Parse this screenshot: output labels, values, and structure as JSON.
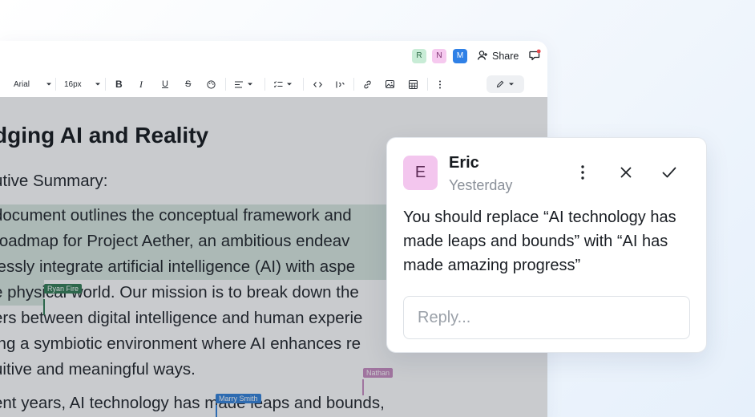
{
  "topbar": {
    "collaborators": [
      {
        "initial": "R",
        "bg": "#c8ecd6",
        "fg": "#2e6b47"
      },
      {
        "initial": "N",
        "bg": "#f6c9ef",
        "fg": "#7a2f6e"
      },
      {
        "initial": "M",
        "bg": "#2f80e6",
        "fg": "#ffffff"
      }
    ],
    "share_label": "Share",
    "notification_color": "#e5484d"
  },
  "toolbar": {
    "font_family": "Arial",
    "font_size": "16px"
  },
  "document": {
    "title": "dging AI and Reality",
    "section": "utive Summary:",
    "lines": [
      "document outlines the conceptual framework and",
      " roadmap for Project Aether, an ambitious endeav",
      "lessly integrate artificial intelligence (AI) with aspe",
      "e physical world. Our mission is to break down the",
      "ers between digital intelligence and human experie",
      "ing a symbiotic environment where AI enhances re",
      "uitive and meaningful ways."
    ],
    "next_paragraph": "ent years, AI technology has made leaps and bounds,",
    "cursors": [
      {
        "name": "Ryan Fire",
        "color": "#2f7a52"
      },
      {
        "name": "Nathan",
        "color": "#c98bc0"
      },
      {
        "name": "Marry Smith",
        "color": "#2f7fd8"
      }
    ]
  },
  "comment": {
    "author_initial": "E",
    "author": "Eric",
    "time": "Yesterday",
    "text": "You should replace “AI technology has made leaps and bounds” with “AI has made amazing progress”",
    "reply_placeholder": "Reply..."
  }
}
